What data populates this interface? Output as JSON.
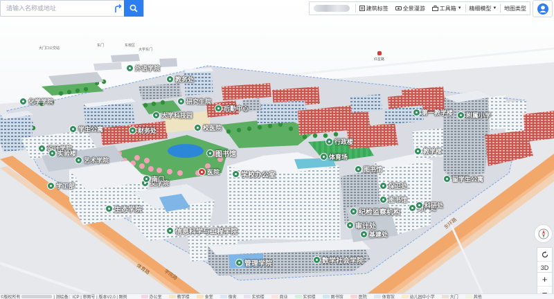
{
  "search": {
    "placeholder": "请输入名称或地址"
  },
  "toolbar": {
    "buildings_label": "建筑标签",
    "panorama_label": "全景漫游",
    "toolbox_label": "工具箱",
    "model_label": "精细模型",
    "map_type_label": "地图类型"
  },
  "map": {
    "labels": [
      {
        "text": "图书馆",
        "kind": "green"
      },
      {
        "text": "学校办公室",
        "kind": "green"
      },
      {
        "text": "生态学院",
        "kind": "green"
      },
      {
        "text": "信息科学与工程学院",
        "kind": "green"
      },
      {
        "text": "管理学院",
        "kind": "green"
      },
      {
        "text": "数学社会学院",
        "kind": "green"
      },
      {
        "text": "纪检监察机构",
        "kind": "green"
      },
      {
        "text": "审计处",
        "kind": "green"
      },
      {
        "text": "基建处",
        "kind": "green"
      },
      {
        "text": "资产处",
        "kind": "green"
      },
      {
        "text": "科研处",
        "kind": "green"
      },
      {
        "text": "图书馆",
        "kind": "green"
      },
      {
        "text": "保卫处",
        "kind": "green"
      },
      {
        "text": "医院",
        "kind": "red"
      },
      {
        "text": "体育场",
        "kind": "green"
      },
      {
        "text": "行政楼",
        "kind": "green"
      },
      {
        "text": "图书馆",
        "kind": "green"
      },
      {
        "text": "留学生公寓",
        "kind": "green"
      },
      {
        "text": "教学楼",
        "kind": "green"
      },
      {
        "text": "第一教学楼",
        "kind": "green"
      },
      {
        "text": "化学学院",
        "kind": "green"
      },
      {
        "text": "文学院",
        "kind": "green"
      },
      {
        "text": "设计学院",
        "kind": "green"
      },
      {
        "text": "实验楼",
        "kind": "green"
      },
      {
        "text": "大学科技园",
        "kind": "green"
      },
      {
        "text": "艺术学院",
        "kind": "green"
      },
      {
        "text": "学生公寓",
        "kind": "green"
      },
      {
        "text": "财务处",
        "kind": "green"
      },
      {
        "text": "校医院",
        "kind": "green"
      },
      {
        "text": "后勤中心",
        "kind": "green"
      },
      {
        "text": "研究生院",
        "kind": "green"
      },
      {
        "text": "教务处",
        "kind": "green"
      },
      {
        "text": "附属小学",
        "kind": "green"
      },
      {
        "text": "外语学院",
        "kind": "green"
      },
      {
        "text": "学工部",
        "kind": "green"
      },
      {
        "text": "南门",
        "kind": "green"
      }
    ],
    "small_labels": [
      "大门口公交站",
      "东门",
      "东校区",
      "大学东门",
      "红星路"
    ],
    "road_labels": [
      "体育路",
      "学院路",
      "东环路"
    ]
  },
  "controls": {
    "mode_3d": "3D",
    "zoom_in": "+",
    "zoom_out": "−"
  },
  "footer": {
    "copyright": "©版权所有",
    "copy_tail": "| 测绘备：ICP | 审图号 | 版本V2.0 | 图例",
    "legend": [
      {
        "label": "办公室",
        "color": "#f4d6e8"
      },
      {
        "label": "教学楼",
        "color": "#f6e7c8"
      },
      {
        "label": "食堂",
        "color": "#fbe0b8"
      },
      {
        "label": "宿舍",
        "color": "#d8e8fa"
      },
      {
        "label": "实验楼",
        "color": "#e7e1f4"
      },
      {
        "label": "商业",
        "color": "#fde2dd"
      },
      {
        "label": "实验楼",
        "color": "#d5f0dd"
      },
      {
        "label": "图书馆",
        "color": "#cfe6f7"
      },
      {
        "label": "医院",
        "color": "#ffd3d3"
      },
      {
        "label": "体育馆",
        "color": "#dde7f1"
      },
      {
        "label": "幼儿园中小学",
        "color": "#fbe9c8"
      },
      {
        "label": "大门",
        "color": "#e9e2d8"
      },
      {
        "label": "其他",
        "color": "#eef3e0"
      }
    ]
  }
}
